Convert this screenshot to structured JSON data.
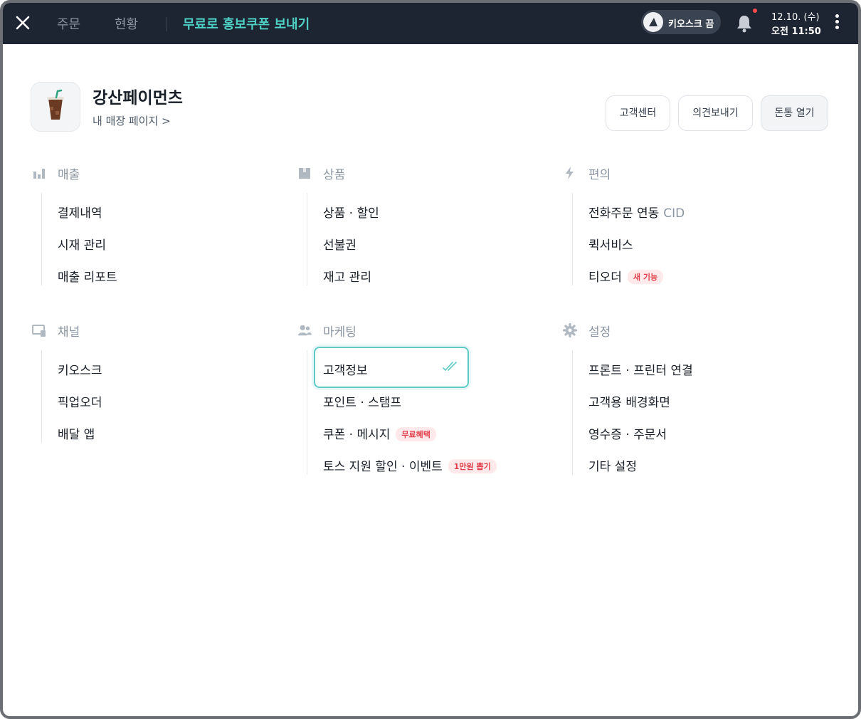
{
  "topbar": {
    "tabs": [
      "주문",
      "현황"
    ],
    "promo": "무료로 홍보쿠폰 보내기",
    "kiosk_label": "키오스크 끔",
    "date": "12.10. (수)",
    "time": "오전 11:50"
  },
  "store": {
    "name": "강산페이먼츠",
    "link": "내 매장 페이지 >",
    "buttons": [
      "고객센터",
      "의견보내기",
      "돈통 열기"
    ]
  },
  "groups": [
    {
      "title": "매출",
      "icon": "bar-chart-icon",
      "items": [
        "결제내역",
        "시재 관리",
        "매출 리포트"
      ]
    },
    {
      "title": "상품",
      "icon": "box-icon",
      "items": [
        "상품 · 할인",
        "선불권",
        "재고 관리"
      ]
    },
    {
      "title": "편의",
      "icon": "lightning-icon",
      "items": [
        "전화주문 연동",
        "퀵서비스",
        "티오더"
      ],
      "cid": "CID",
      "new_badge": "새 기능"
    },
    {
      "title": "채널",
      "icon": "monitor-icon",
      "items": [
        "키오스크",
        "픽업오더",
        "배달 앱"
      ]
    },
    {
      "title": "마케팅",
      "icon": "users-icon",
      "items": [
        "고객정보",
        "포인트 · 스탬프",
        "쿠폰 · 메시지",
        "토스 지원 할인 · 이벤트"
      ],
      "badges": [
        "무료혜택",
        "1만원 뽑기"
      ]
    },
    {
      "title": "설정",
      "icon": "gear-icon",
      "items": [
        "프론트 · 프린터 연결",
        "고객용 배경화면",
        "영수증 · 주문서",
        "기타 설정"
      ]
    }
  ],
  "colors": {
    "accent": "#4fd1c5",
    "topbar": "#1d2532",
    "badge": "#e03e4a"
  }
}
